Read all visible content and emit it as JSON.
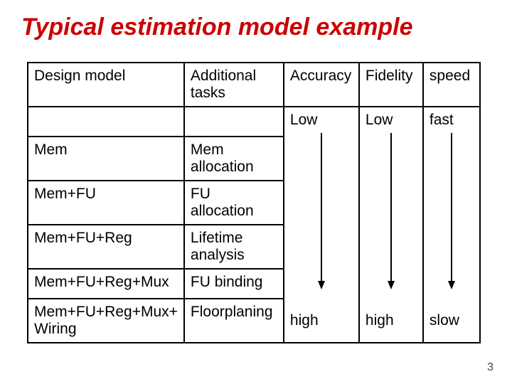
{
  "title": "Typical estimation model example",
  "page_number": "3",
  "table": {
    "headers": {
      "c1": "Design model",
      "c2": "Additional tasks",
      "c3": "Accuracy",
      "c4": "Fidelity",
      "c5": "speed"
    },
    "scale": {
      "accuracy_top": "Low",
      "accuracy_bottom": "high",
      "fidelity_top": "Low",
      "fidelity_bottom": "high",
      "speed_top": "fast",
      "speed_bottom": "slow"
    },
    "rows": [
      {
        "model": "",
        "task": ""
      },
      {
        "model": "Mem",
        "task": "Mem allocation"
      },
      {
        "model": "Mem+FU",
        "task": "FU allocation"
      },
      {
        "model": "Mem+FU+Reg",
        "task": "Lifetime analysis"
      },
      {
        "model": "Mem+FU+Reg+Mux",
        "task": "FU binding"
      },
      {
        "model": "Mem+FU+Reg+Mux+ Wiring",
        "task": "Floorplaning"
      }
    ]
  }
}
